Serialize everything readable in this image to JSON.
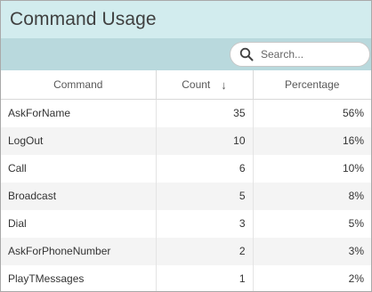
{
  "header": {
    "title": "Command Usage"
  },
  "search": {
    "placeholder": "Search..."
  },
  "table": {
    "columns": [
      {
        "label": "Command"
      },
      {
        "label": "Count",
        "sort_icon": "arrow-down-icon",
        "sort_direction": "descending"
      },
      {
        "label": "Percentage"
      }
    ],
    "rows": [
      {
        "command": "AskForName",
        "count": "35",
        "percentage": "56%"
      },
      {
        "command": "LogOut",
        "count": "10",
        "percentage": "16%"
      },
      {
        "command": "Call",
        "count": "6",
        "percentage": "10%"
      },
      {
        "command": "Broadcast",
        "count": "5",
        "percentage": "8%"
      },
      {
        "command": "Dial",
        "count": "3",
        "percentage": "5%"
      },
      {
        "command": "AskForPhoneNumber",
        "count": "2",
        "percentage": "3%"
      },
      {
        "command": "PlayTMessages",
        "count": "1",
        "percentage": "2%"
      }
    ]
  },
  "colors": {
    "header_bg": "#d2ecee",
    "toolbar_bg": "#b9d9dd",
    "row_alt_bg": "#f4f4f4"
  }
}
